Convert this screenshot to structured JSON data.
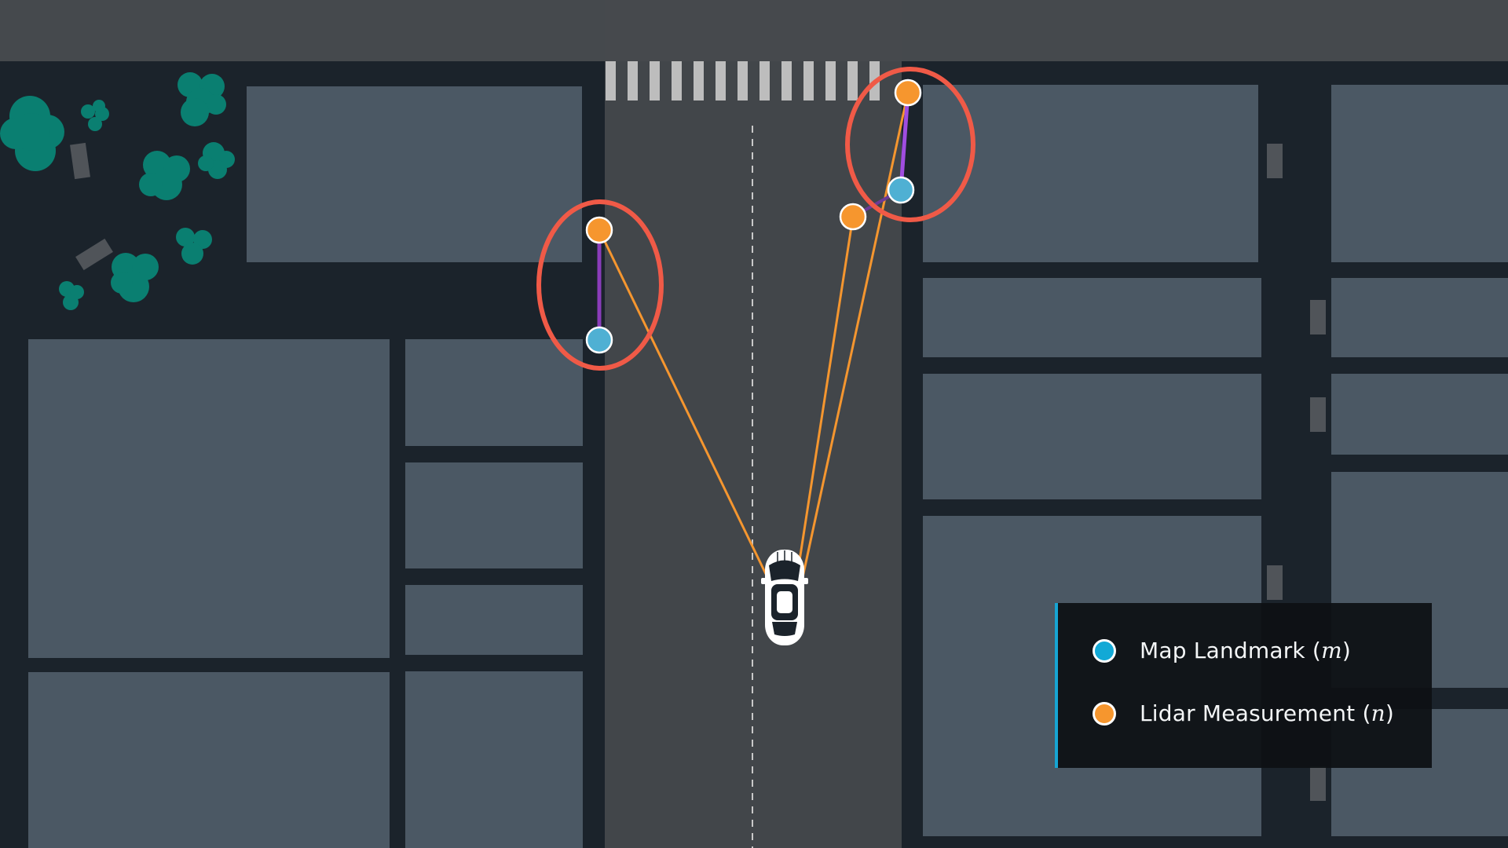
{
  "scene": {
    "colors": {
      "background": "#1b232b",
      "building": "#4b5864",
      "road": "#42464a",
      "top_road": "#45494d",
      "tree": "#0a7f71",
      "landmark": "#4fb0d3",
      "measurement": "#f6962e",
      "association": "#8c45c9",
      "lidar_ray": "#f5962f",
      "highlight": "#f05a47",
      "crosswalk": "#bdbdbd"
    },
    "icons": [
      "car-icon",
      "tree-icon"
    ]
  },
  "legend": {
    "items": [
      {
        "label": "Map Landmark (",
        "var": "m",
        "suffix": ")",
        "color": "#12a9d6",
        "icon": "circle"
      },
      {
        "label": "Lidar Measurement (",
        "var": "n",
        "suffix": ")",
        "color": "#f6962e",
        "icon": "circle"
      }
    ]
  }
}
